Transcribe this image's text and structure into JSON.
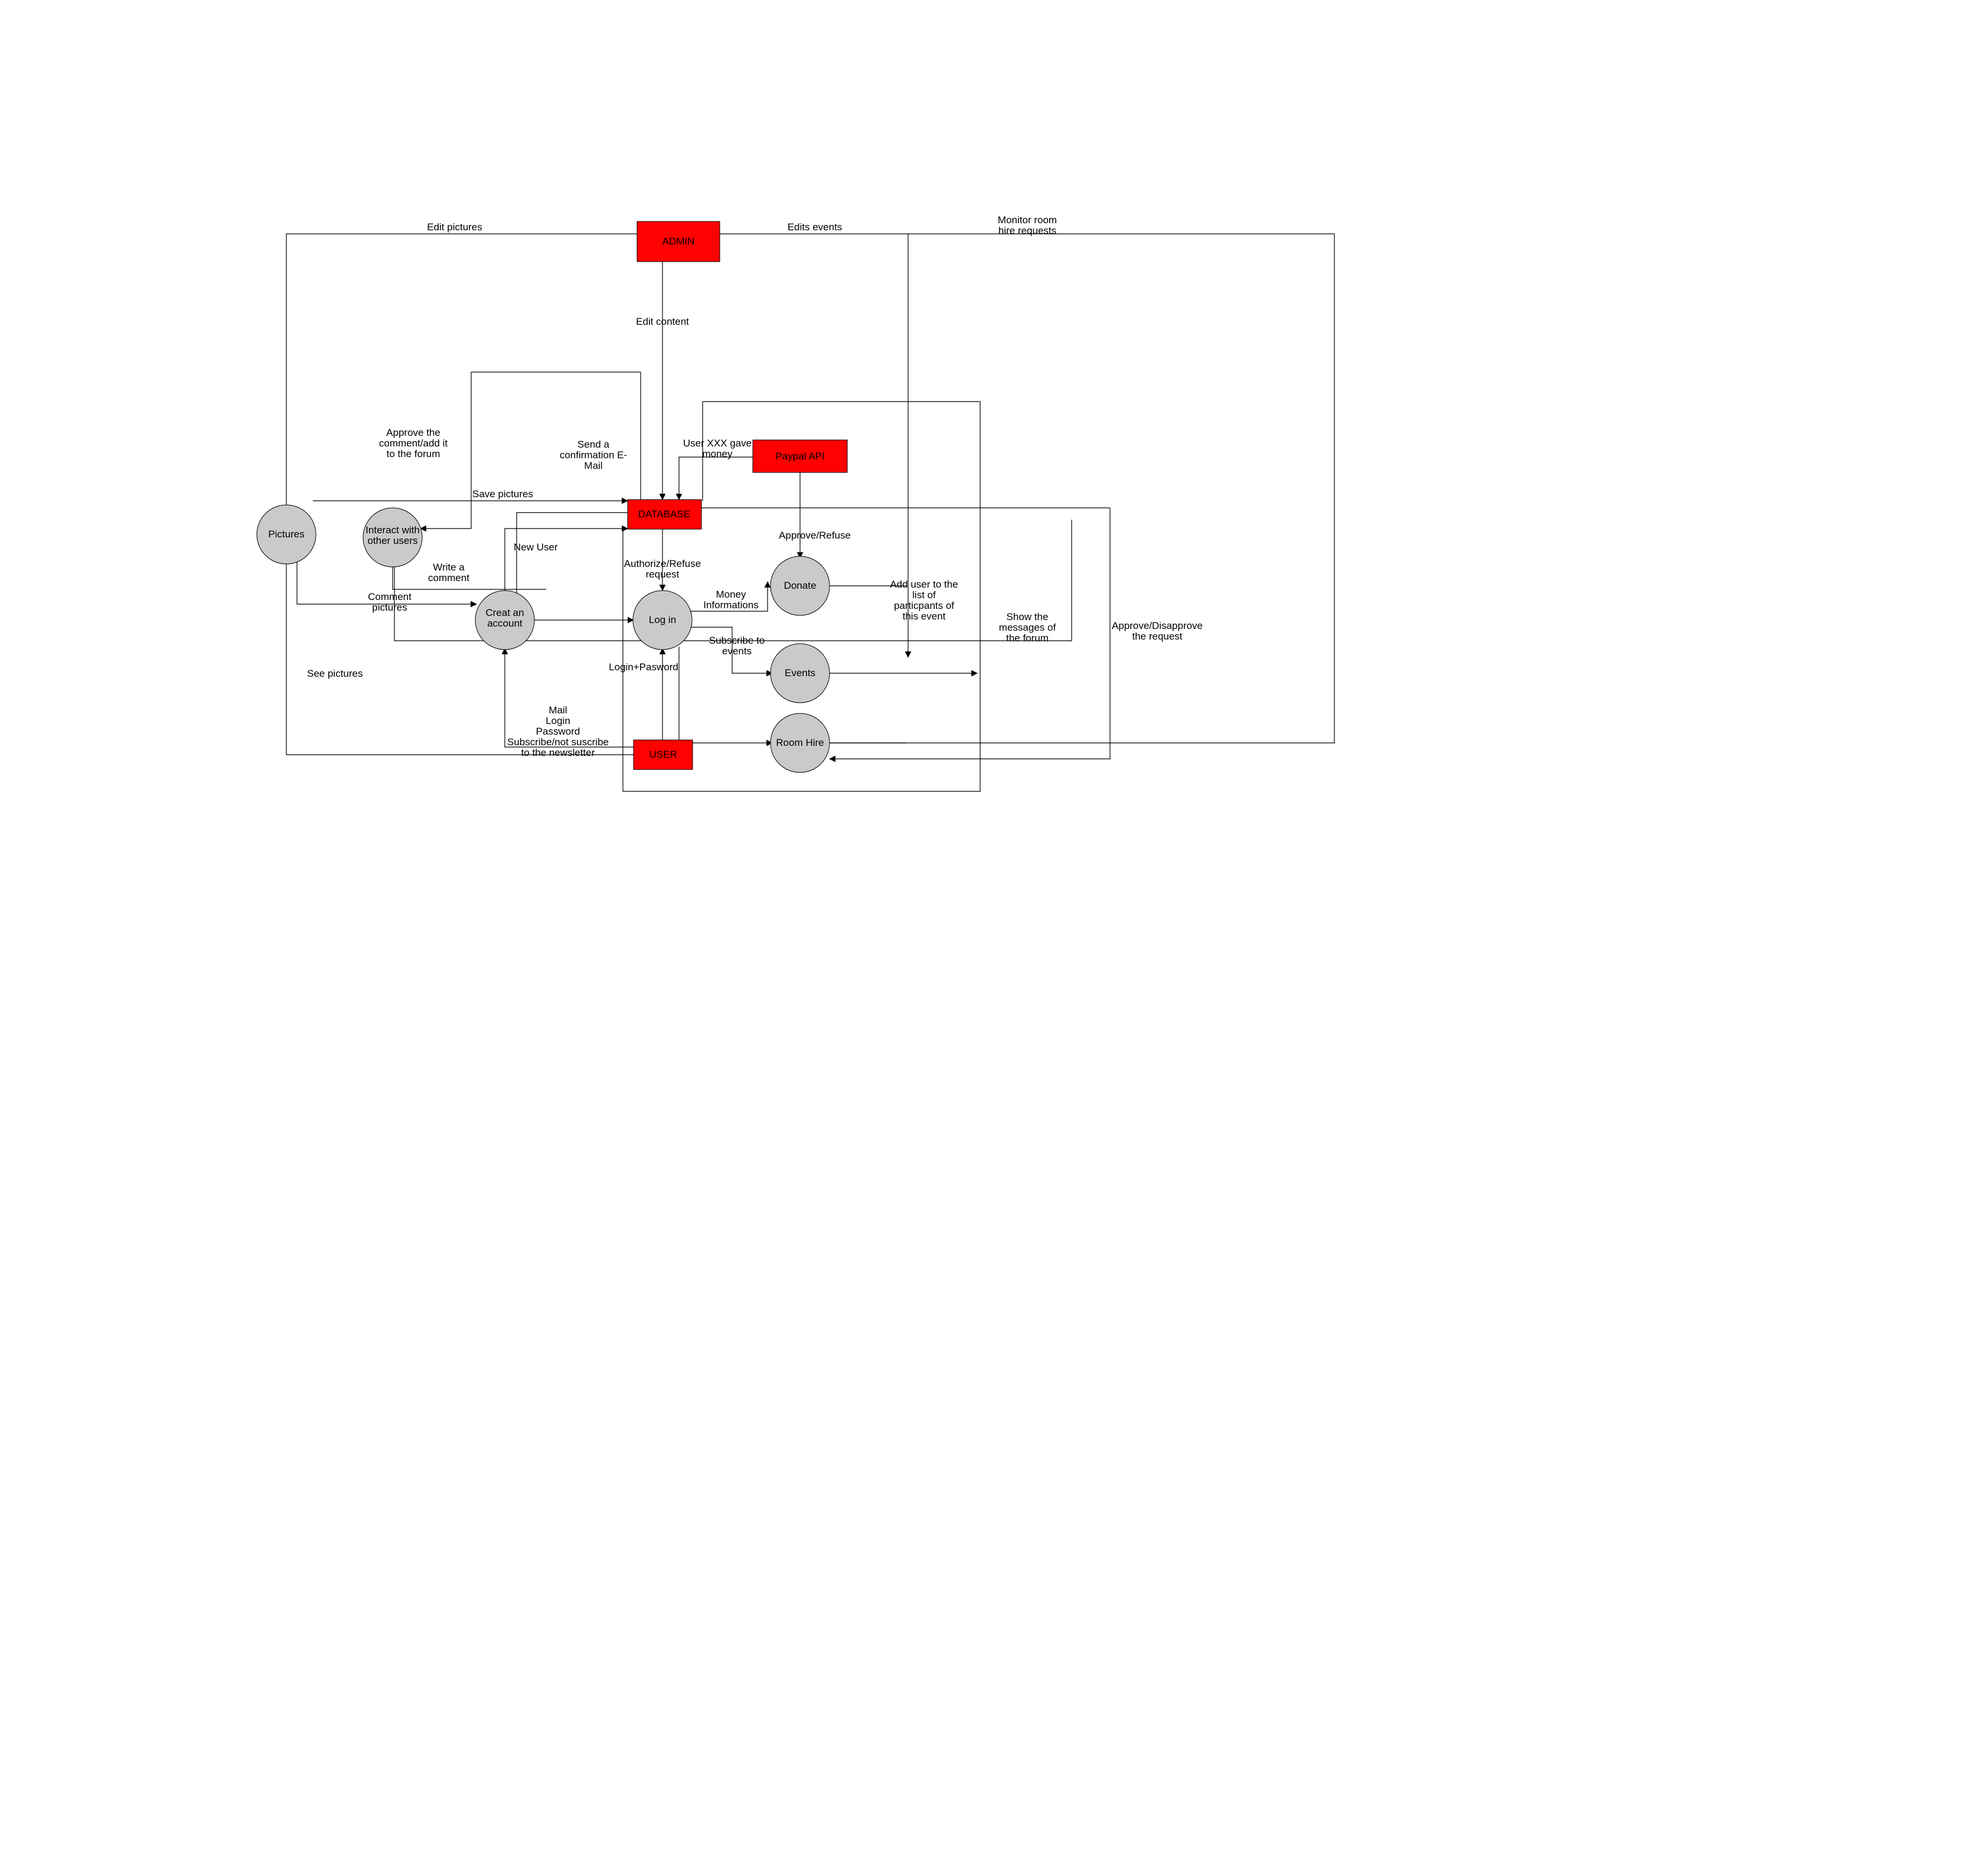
{
  "nodes": {
    "admin": {
      "label": "ADMIN"
    },
    "paypal": {
      "label": "Paypal API"
    },
    "database": {
      "label": "DATABASE"
    },
    "user": {
      "label": "USER"
    },
    "pictures": {
      "label": "Pictures"
    },
    "interact": {
      "label_lines": [
        "Interact with",
        "other users"
      ]
    },
    "create": {
      "label_lines": [
        "Creat an",
        "account"
      ]
    },
    "login": {
      "label": "Log in"
    },
    "donate": {
      "label": "Donate"
    },
    "events": {
      "label": "Events"
    },
    "roomhire": {
      "label": "Room Hire"
    }
  },
  "edges": {
    "edit_pictures": {
      "label": "Edit pictures"
    },
    "edits_events": {
      "label": "Edits events"
    },
    "monitor_room": {
      "label_lines": [
        "Monitor room",
        "hire requests"
      ]
    },
    "edit_content": {
      "label": "Edit content"
    },
    "approve_comment": {
      "label_lines": [
        "Approve the",
        "comment/add it",
        "to the forum"
      ]
    },
    "user_gave": {
      "label_lines": [
        "User XXX gave",
        "money"
      ]
    },
    "send_confirm": {
      "label_lines": [
        "Send a",
        "confirmation E-",
        "Mail"
      ]
    },
    "save_pictures": {
      "label": "Save pictures"
    },
    "write_comment": {
      "label_lines": [
        "Write a",
        "comment"
      ]
    },
    "new_user": {
      "label": "New User"
    },
    "approve_refuse_money": {
      "label": "Approve/Refuse"
    },
    "authorize_refuse": {
      "label_lines": [
        "Authorize/Refuse",
        "request"
      ]
    },
    "money_info": {
      "label_lines": [
        "Money",
        "Informations"
      ]
    },
    "add_user_event": {
      "label_lines": [
        "Add user to the",
        "list of",
        "particpants of",
        "this event"
      ]
    },
    "comment_pictures": {
      "label_lines": [
        "Comment",
        "pictures"
      ]
    },
    "subscribe_events": {
      "label_lines": [
        "Subscribe to",
        "events"
      ]
    },
    "show_messages": {
      "label_lines": [
        "Show the",
        "messages of",
        "the forum"
      ]
    },
    "approve_request": {
      "label_lines": [
        "Approve/Disapprove",
        "the request"
      ]
    },
    "login_password": {
      "label": "Login+Pasword"
    },
    "see_pictures": {
      "label": "See pictures"
    },
    "user_details": {
      "label_lines": [
        "Mail",
        "Login",
        "Password",
        "Subscribe/not suscribe",
        "to the newsletter"
      ]
    }
  }
}
